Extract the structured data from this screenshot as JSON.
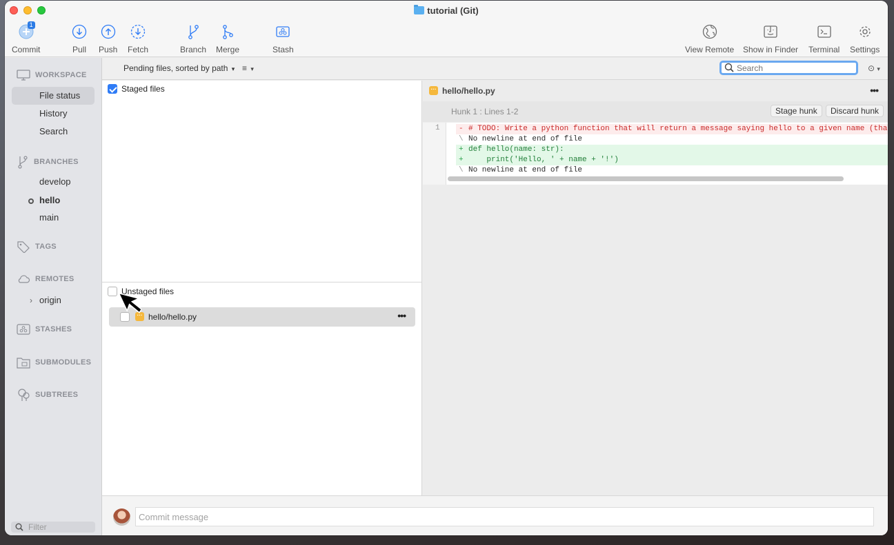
{
  "window": {
    "title": "tutorial (Git)"
  },
  "toolbar": {
    "commit": {
      "label": "Commit",
      "badge": "1"
    },
    "pull": "Pull",
    "push": "Push",
    "fetch": "Fetch",
    "branch": "Branch",
    "merge": "Merge",
    "stash": "Stash",
    "view_remote": "View Remote",
    "show_in_finder": "Show in Finder",
    "terminal": "Terminal",
    "settings": "Settings"
  },
  "sidebar": {
    "workspace": {
      "header": "WORKSPACE",
      "items": [
        "File status",
        "History",
        "Search"
      ],
      "active": "File status"
    },
    "branches": {
      "header": "BRANCHES",
      "items": [
        "develop",
        "hello",
        "main"
      ],
      "current": "hello"
    },
    "tags": {
      "header": "TAGS"
    },
    "remotes": {
      "header": "REMOTES",
      "items": [
        "origin"
      ]
    },
    "stashes": {
      "header": "STASHES"
    },
    "submodules": {
      "header": "SUBMODULES"
    },
    "subtrees": {
      "header": "SUBTREES"
    },
    "filter_placeholder": "Filter"
  },
  "subbar": {
    "sort_label": "Pending files, sorted by path",
    "search_placeholder": "Search"
  },
  "files": {
    "staged_header": "Staged files",
    "staged_checked": true,
    "unstaged_header": "Unstaged files",
    "unstaged_checked": false,
    "unstaged_items": [
      {
        "name": "hello/hello.py",
        "status": "modified"
      }
    ]
  },
  "diff": {
    "file_path": "hello/hello.py",
    "hunk_label": "Hunk 1 : Lines 1-2",
    "stage_hunk": "Stage hunk",
    "discard_hunk": "Discard hunk",
    "lines": [
      {
        "type": "del",
        "marker": "-",
        "number": "1",
        "text": "# TODO: Write a python function that will return a message saying hello to a given name (that is a st"
      },
      {
        "type": "meta",
        "marker": "\\",
        "number": "",
        "text": "No newline at end of file"
      },
      {
        "type": "add",
        "marker": "+",
        "number": "",
        "text": "def hello(name: str):"
      },
      {
        "type": "add",
        "marker": "+",
        "number": "",
        "text": "    print('Hello, ' + name + '!')"
      },
      {
        "type": "meta",
        "marker": "\\",
        "number": "",
        "text": "No newline at end of file"
      }
    ]
  },
  "commit": {
    "placeholder": "Commit message"
  },
  "colors": {
    "accent": "#2f7cf6",
    "modified": "#f5b83d",
    "deletion": "#c92a2a",
    "addition": "#23803a"
  }
}
